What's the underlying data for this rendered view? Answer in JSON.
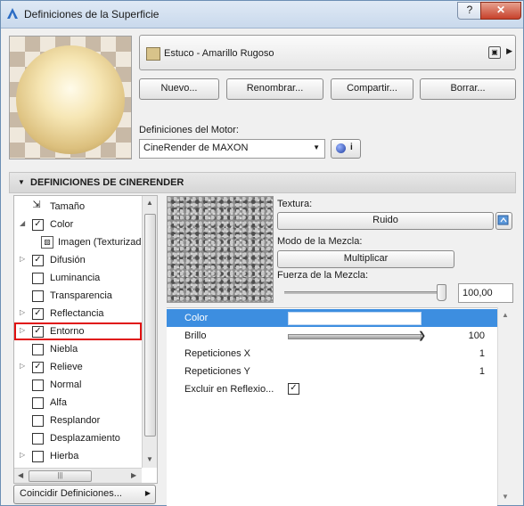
{
  "window": {
    "title": "Definiciones de la Superficie",
    "help_label": "?",
    "close_label": "✕"
  },
  "surface": {
    "name": "Estuco - Amarillo Rugoso",
    "swatch_color": "#d8c38a"
  },
  "actions": {
    "new": "Nuevo...",
    "rename": "Renombrar...",
    "share": "Compartir...",
    "delete": "Borrar..."
  },
  "engine": {
    "label": "Definiciones del Motor:",
    "value": "CineRender de MAXON"
  },
  "section": {
    "title": "DEFINICIONES DE CINERENDER"
  },
  "tree": {
    "items": [
      {
        "label": "Tamaño",
        "checked": null
      },
      {
        "label": "Color",
        "checked": true
      },
      {
        "label": "Imagen (Texturizad",
        "checked": null
      },
      {
        "label": "Difusión",
        "checked": true
      },
      {
        "label": "Luminancia",
        "checked": false
      },
      {
        "label": "Transparencia",
        "checked": false
      },
      {
        "label": "Reflectancia",
        "checked": true
      },
      {
        "label": "Entorno",
        "checked": true
      },
      {
        "label": "Niebla",
        "checked": false
      },
      {
        "label": "Relieve",
        "checked": true
      },
      {
        "label": "Normal",
        "checked": false
      },
      {
        "label": "Alfa",
        "checked": false
      },
      {
        "label": "Resplandor",
        "checked": false
      },
      {
        "label": "Desplazamiento",
        "checked": false
      },
      {
        "label": "Hierba",
        "checked": false
      }
    ],
    "selected": "Entorno",
    "match_button": "Coincidir Definiciones..."
  },
  "texture": {
    "label": "Textura:",
    "value": "Ruido"
  },
  "mix_mode": {
    "label": "Modo de la Mezcla:",
    "value": "Multiplicar"
  },
  "mix_strength": {
    "label": "Fuerza de la Mezcla:",
    "value": "100,00",
    "level": 1.0
  },
  "properties": [
    {
      "name": "Color",
      "value": ""
    },
    {
      "name": "Brillo",
      "value": "100",
      "level": 1.0
    },
    {
      "name": "Repeticiones X",
      "value": "1"
    },
    {
      "name": "Repeticiones Y",
      "value": "1"
    },
    {
      "name": "Excluir en Reflexio...",
      "value": "",
      "checked": true
    }
  ],
  "colors": {
    "accent": "#3d8ee0",
    "selection_outline": "#e01010"
  }
}
